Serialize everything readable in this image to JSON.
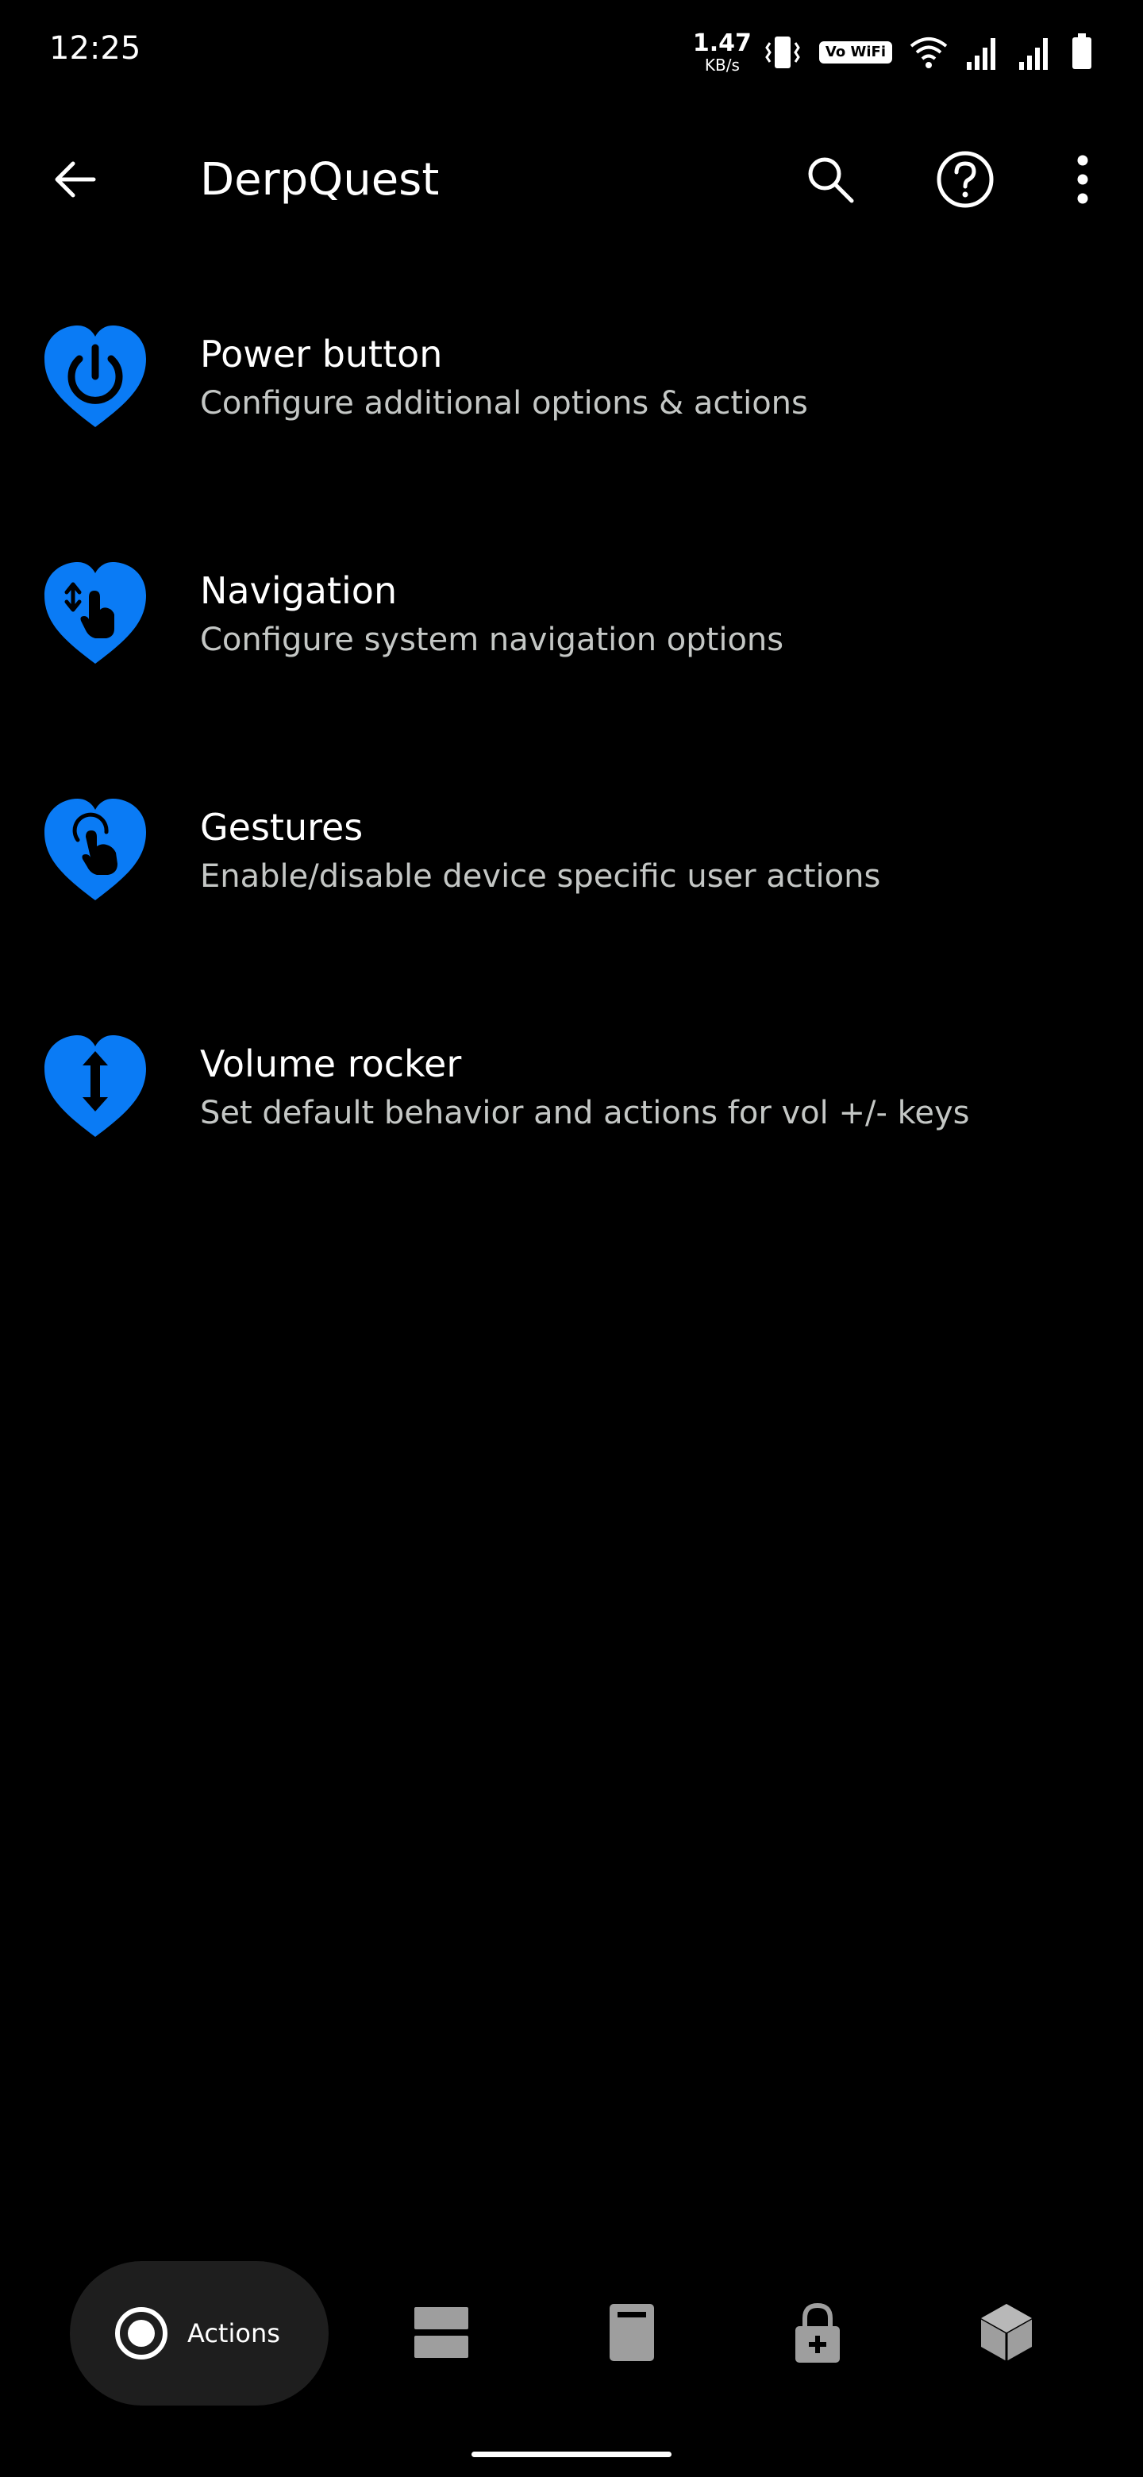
{
  "status_bar": {
    "time": "12:25",
    "net_speed_value": "1.47",
    "net_speed_unit": "KB/s",
    "volte_label": "Vo WiFi",
    "icons": [
      "network-speed",
      "vibrate-icon",
      "volte-wifi-icon",
      "wifi-icon",
      "signal-icon",
      "signal-icon",
      "battery-icon"
    ]
  },
  "app_bar": {
    "title": "DerpQuest",
    "actions": [
      "back-arrow-icon",
      "search-icon",
      "help-icon",
      "more-vert-icon"
    ]
  },
  "settings": {
    "items": [
      {
        "title": "Power button",
        "summary": "Configure additional options & actions",
        "icon": "power-heart-icon"
      },
      {
        "title": "Navigation",
        "summary": "Configure system navigation options",
        "icon": "navigation-heart-icon"
      },
      {
        "title": "Gestures",
        "summary": "Enable/disable device specific user actions",
        "icon": "gestures-heart-icon"
      },
      {
        "title": "Volume rocker",
        "summary": "Set default behavior and actions for vol +/- keys",
        "icon": "volume-heart-icon"
      }
    ]
  },
  "bottom_nav": {
    "active_label": "Actions",
    "items": [
      "actions-icon",
      "layout-icon",
      "device-icon",
      "lock-icon",
      "box-icon"
    ]
  },
  "colors": {
    "accent": "#0A7BF5",
    "background": "#000000",
    "summary_text": "#C4C7C5",
    "nav_pill": "#1E1E1E",
    "nav_inactive": "#9E9E9E"
  }
}
